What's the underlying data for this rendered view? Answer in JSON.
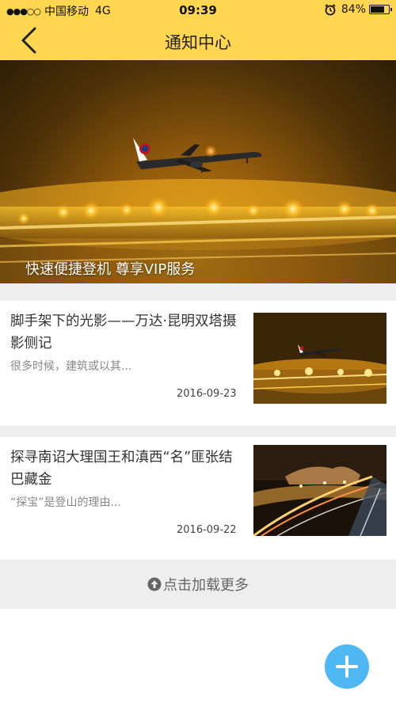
{
  "status_bar": {
    "carrier": "中国移动",
    "network": "4G",
    "time": "09:39",
    "battery": "84%",
    "signal_dots": "●●●○○"
  },
  "nav": {
    "title": "通知中心",
    "back_icon": "chevron-left-icon"
  },
  "banner": {
    "caption": "快速便捷登机 尊享VIP服务"
  },
  "articles": [
    {
      "title": "脚手架下的光影——万达·昆明双塔摄影侧记",
      "summary": "很多时候，建筑或以其...",
      "date": "2016-09-23"
    },
    {
      "title": "探寻南诏大理国王和滇西“名”匪张结巴藏金",
      "summary": "“探宝”是登山的理由...",
      "date": "2016-09-22"
    }
  ],
  "load_more": {
    "label": "点击加载更多",
    "icon": "arrow-up-circle-icon"
  },
  "fab": {
    "icon": "plus-icon"
  },
  "colors": {
    "header": "#ffd64f",
    "fab": "#4fb8f3",
    "background_gap": "#eeeeee"
  }
}
